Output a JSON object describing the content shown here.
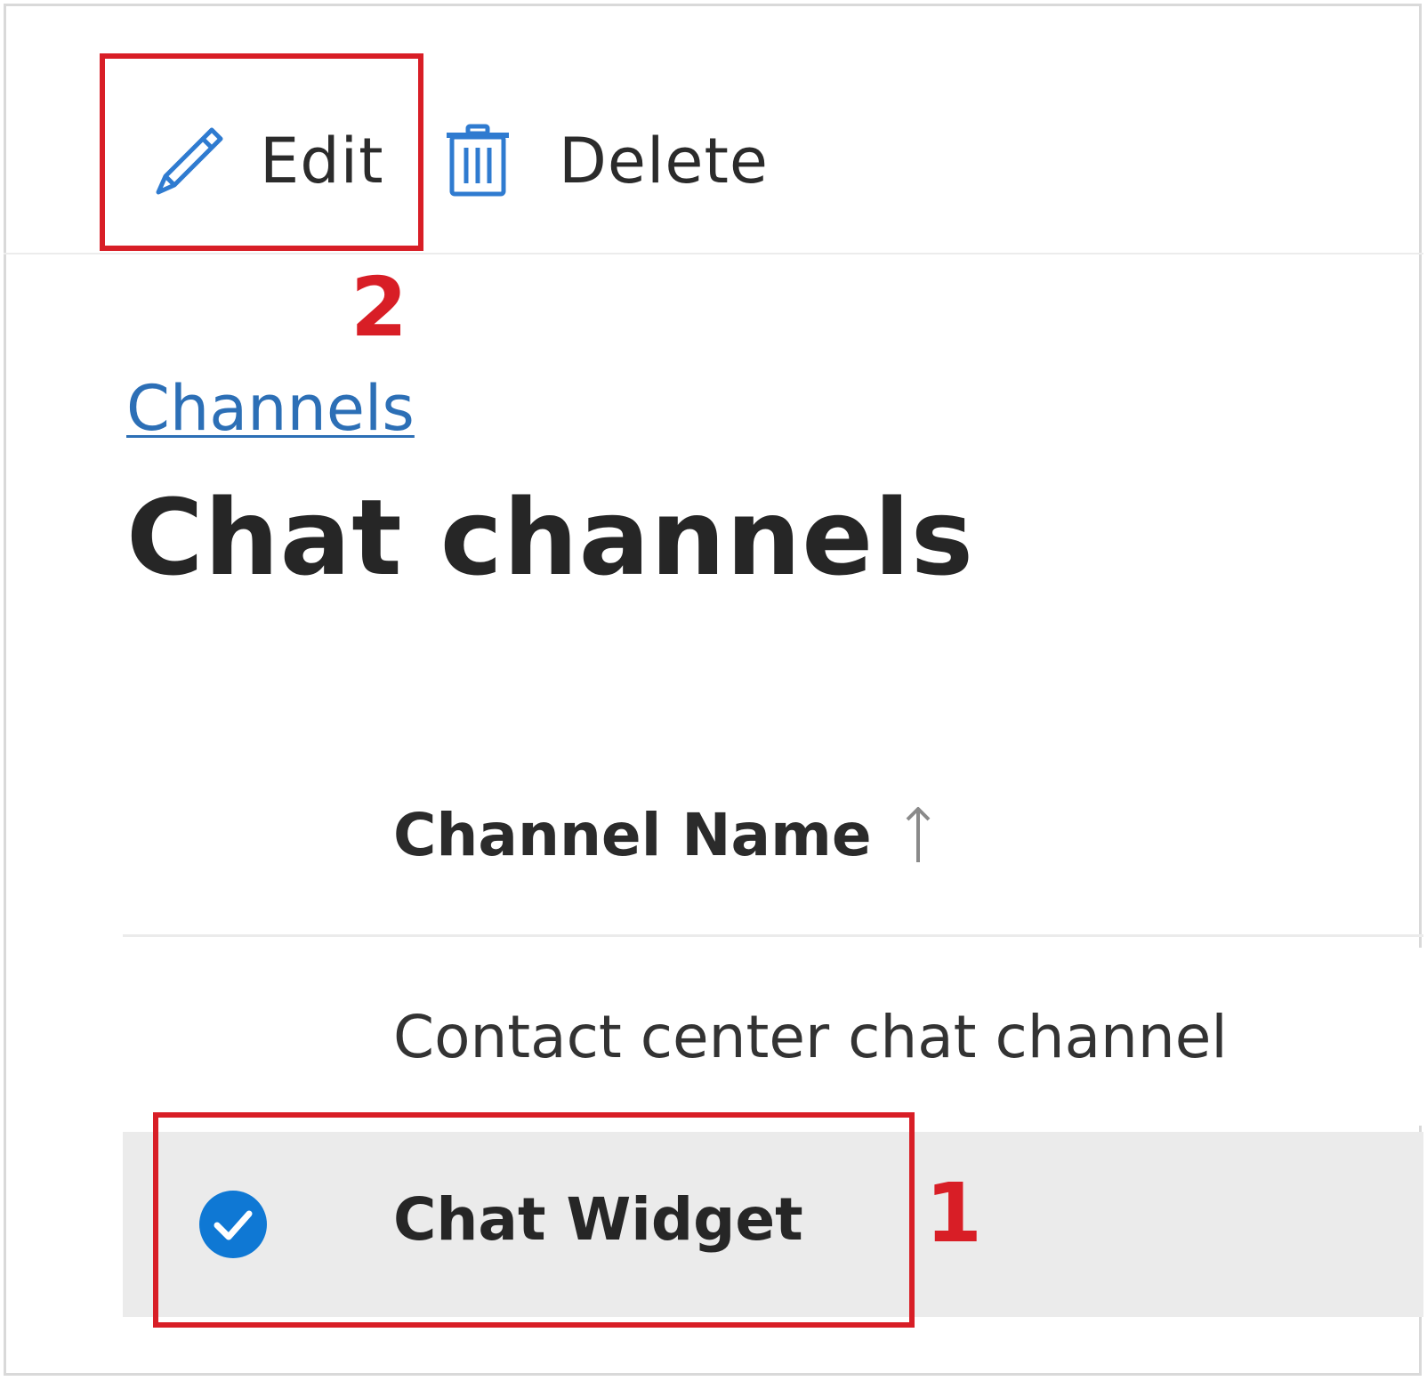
{
  "toolbar": {
    "edit_label": "Edit",
    "delete_label": "Delete",
    "edit_icon": "pencil-icon",
    "delete_icon": "trash-icon"
  },
  "breadcrumb": {
    "label": "Channels"
  },
  "page": {
    "title": "Chat channels"
  },
  "table": {
    "columns": [
      {
        "label": "Channel Name",
        "sort": "ascending"
      }
    ],
    "rows": [
      {
        "name": "Contact center chat channel",
        "selected": false
      },
      {
        "name": "Chat Widget",
        "selected": true
      }
    ]
  },
  "annotations": [
    {
      "label": "1"
    },
    {
      "label": "2"
    }
  ],
  "colors": {
    "accent": "#0f78d4",
    "link": "#2c6fb6",
    "annotation": "#d81e26",
    "selected_row": "#ebebeb"
  }
}
